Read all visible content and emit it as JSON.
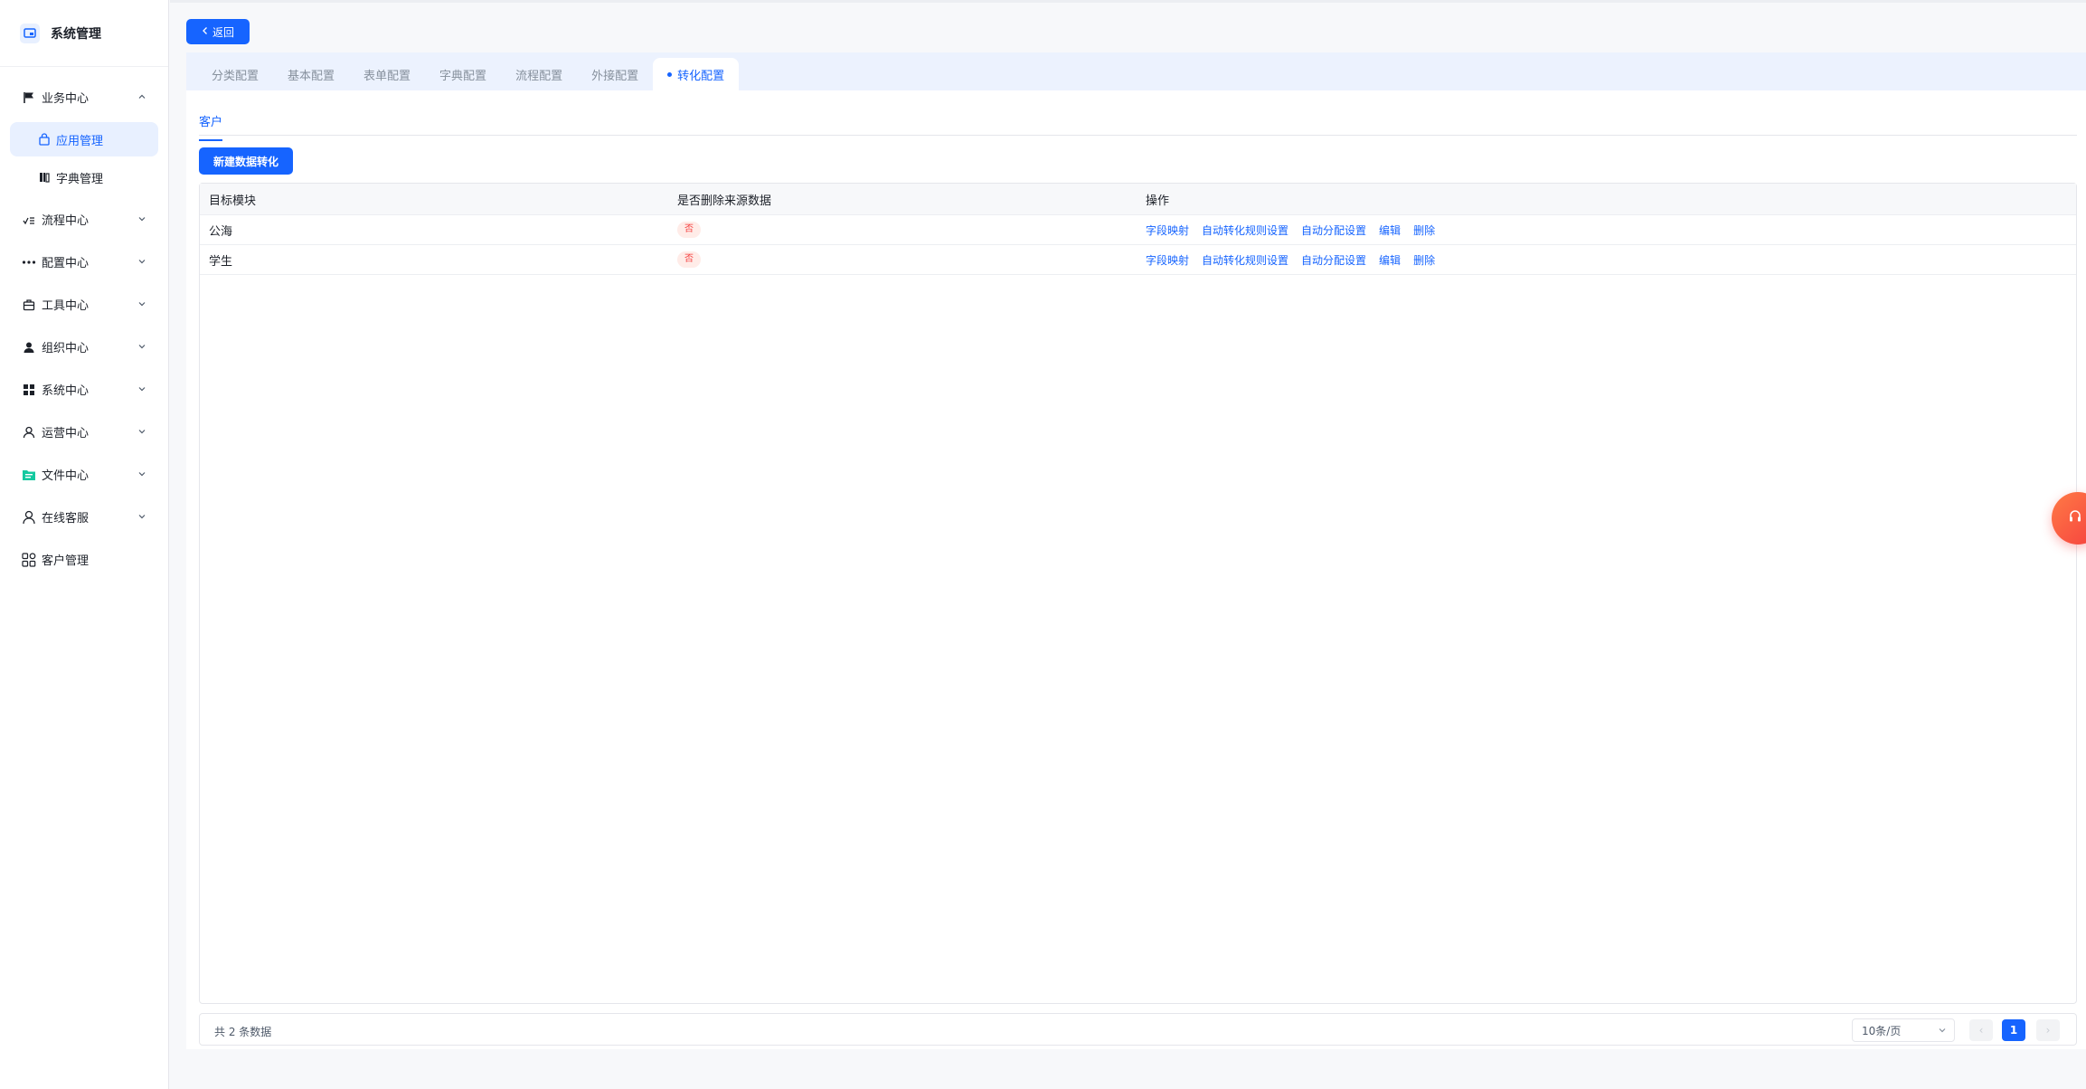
{
  "brand": {
    "title": "系统管理"
  },
  "sidebar": {
    "items": [
      {
        "label": "业务中心",
        "expanded": true,
        "icon": "flag-icon"
      },
      {
        "label": "流程中心",
        "icon": "flow-icon"
      },
      {
        "label": "配置中心",
        "icon": "dots-icon"
      },
      {
        "label": "工具中心",
        "icon": "toolbox-icon"
      },
      {
        "label": "组织中心",
        "icon": "user-icon"
      },
      {
        "label": "系统中心",
        "icon": "grid-icon"
      },
      {
        "label": "运营中心",
        "icon": "person-outline-icon"
      },
      {
        "label": "文件中心",
        "icon": "folder-icon"
      },
      {
        "label": "在线客服",
        "icon": "agent-icon"
      },
      {
        "label": "客户管理",
        "icon": "apps-icon"
      }
    ],
    "sub_items": [
      {
        "label": "应用管理",
        "active": true,
        "icon": "bag-icon"
      },
      {
        "label": "字典管理",
        "icon": "book-icon"
      }
    ]
  },
  "toolbar": {
    "back_label": "返回"
  },
  "tabs": [
    {
      "label": "分类配置"
    },
    {
      "label": "基本配置"
    },
    {
      "label": "表单配置"
    },
    {
      "label": "字典配置"
    },
    {
      "label": "流程配置"
    },
    {
      "label": "外接配置"
    },
    {
      "label": "转化配置",
      "active": true
    }
  ],
  "subtab": {
    "label": "客户"
  },
  "actions": {
    "new_label": "新建数据转化"
  },
  "table": {
    "headers": [
      "目标模块",
      "是否删除来源数据",
      "操作"
    ],
    "rows": [
      {
        "module": "公海",
        "delete_source": "否"
      },
      {
        "module": "学生",
        "delete_source": "否"
      }
    ],
    "operations": [
      "字段映射",
      "自动转化规则设置",
      "自动分配设置",
      "编辑",
      "删除"
    ]
  },
  "pagination": {
    "total_text": "共 2 条数据",
    "page_size": "10条/页",
    "current_page": "1",
    "prev": "‹",
    "next": "›"
  },
  "colors": {
    "primary": "#1664ff",
    "danger": "#f53f3f",
    "tab_bar_bg": "#ecf2fe"
  }
}
